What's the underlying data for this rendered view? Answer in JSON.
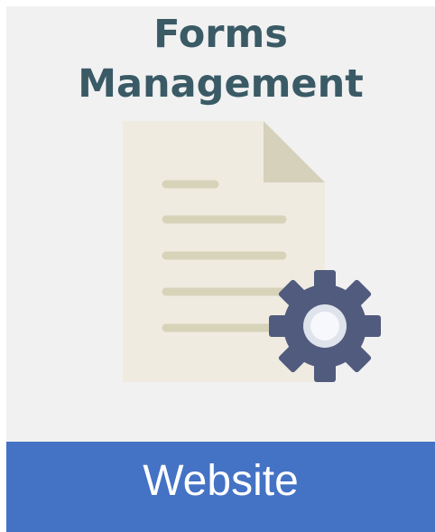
{
  "tile": {
    "title_line_1": "Forms",
    "title_line_2": "Management",
    "footer_label": "Website",
    "icons": {
      "document": "document-icon",
      "gear": "gear-icon"
    },
    "colors": {
      "background": "#f1f1f1",
      "title": "#3a5a66",
      "footer": "#4472c4",
      "footer_text": "#ffffff",
      "document": "#efebe0",
      "document_fold": "#d6d1bb",
      "document_lines": "#d6d3b9",
      "gear": "#515b7e",
      "gear_center": "#e8ecf3"
    }
  }
}
